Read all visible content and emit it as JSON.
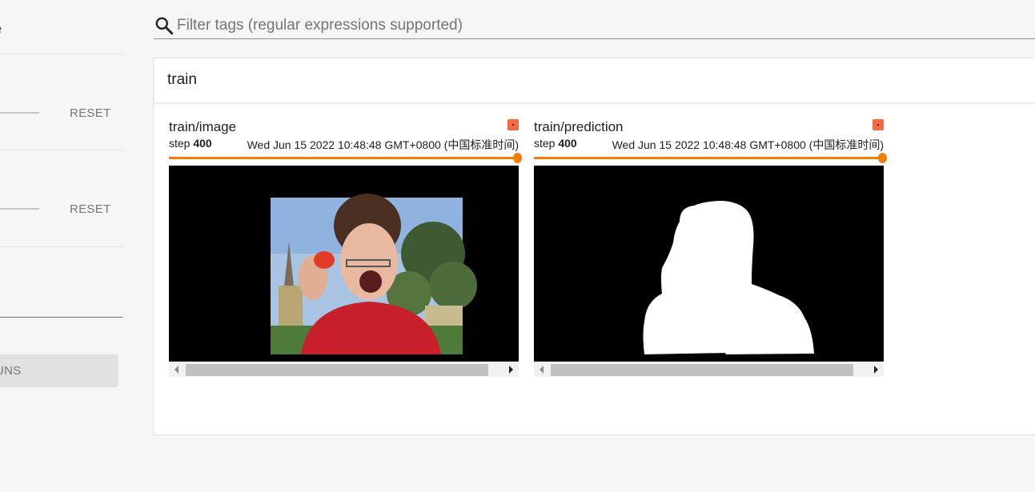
{
  "sidebar": {
    "partial_text": "e",
    "reset_label_1": "RESET",
    "reset_label_2": "RESET",
    "runs_button_partial": "UNS"
  },
  "filter": {
    "placeholder": "Filter tags (regular expressions supported)"
  },
  "card": {
    "title": "train",
    "panels": [
      {
        "tag": "train/image",
        "step_label": "step",
        "step_value": "400",
        "timestamp": "Wed Jun 15 2022 10:48:48 GMT+0800 (中国标准时间)",
        "image": "photo-woman-holding-red-object"
      },
      {
        "tag": "train/prediction",
        "step_label": "step",
        "step_value": "400",
        "timestamp": "Wed Jun 15 2022 10:48:48 GMT+0800 (中国标准时间)",
        "image": "segmentation-mask-silhouette"
      }
    ]
  },
  "colors": {
    "accent": "#f57c00",
    "run_chip": "#f4693e",
    "background": "#f5f5f5"
  }
}
